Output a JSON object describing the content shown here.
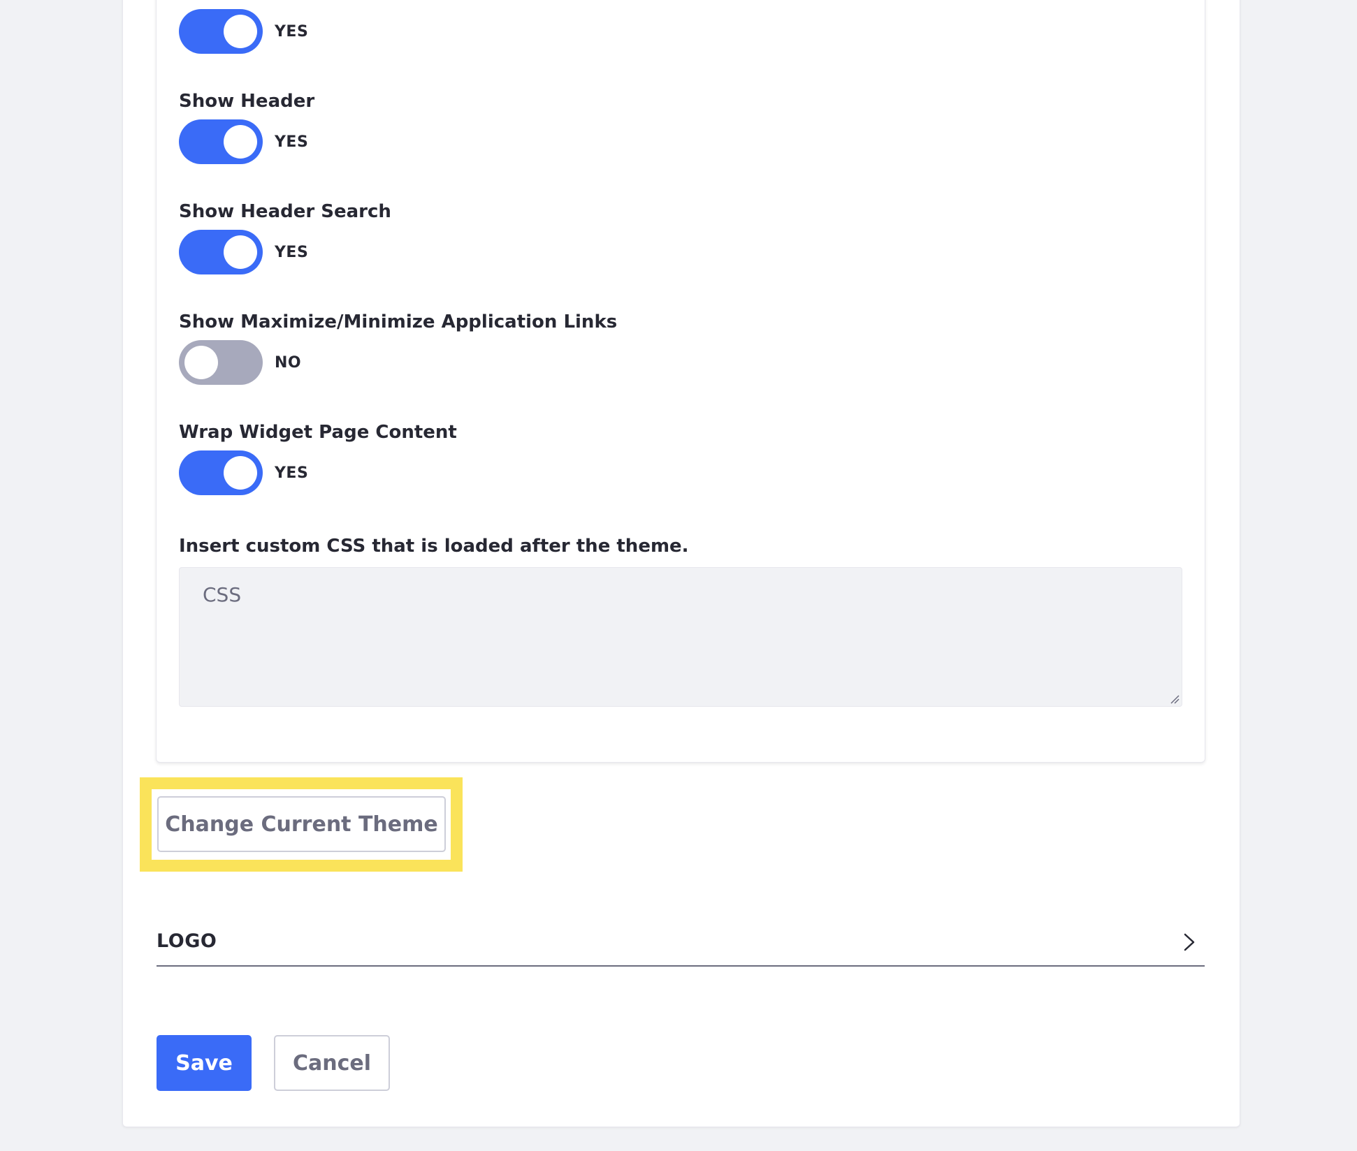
{
  "toggles": [
    {
      "label": "",
      "state_text": "YES",
      "on": true
    },
    {
      "label": "Show Header",
      "state_text": "YES",
      "on": true
    },
    {
      "label": "Show Header Search",
      "state_text": "YES",
      "on": true
    },
    {
      "label": "Show Maximize/Minimize Application Links",
      "state_text": "NO",
      "on": false
    },
    {
      "label": "Wrap Widget Page Content",
      "state_text": "YES",
      "on": true
    }
  ],
  "custom_css": {
    "label": "Insert custom CSS that is loaded after the theme.",
    "placeholder": "CSS",
    "value": ""
  },
  "change_theme_button": "Change Current Theme",
  "logo_panel": {
    "title": "LOGO",
    "expanded": false
  },
  "actions": {
    "save_label": "Save",
    "cancel_label": "Cancel"
  },
  "colors": {
    "primary": "#3a6bf7",
    "toggle_off": "#a7a9bc",
    "highlight": "#fae35a",
    "page_bg": "#f1f2f5"
  }
}
